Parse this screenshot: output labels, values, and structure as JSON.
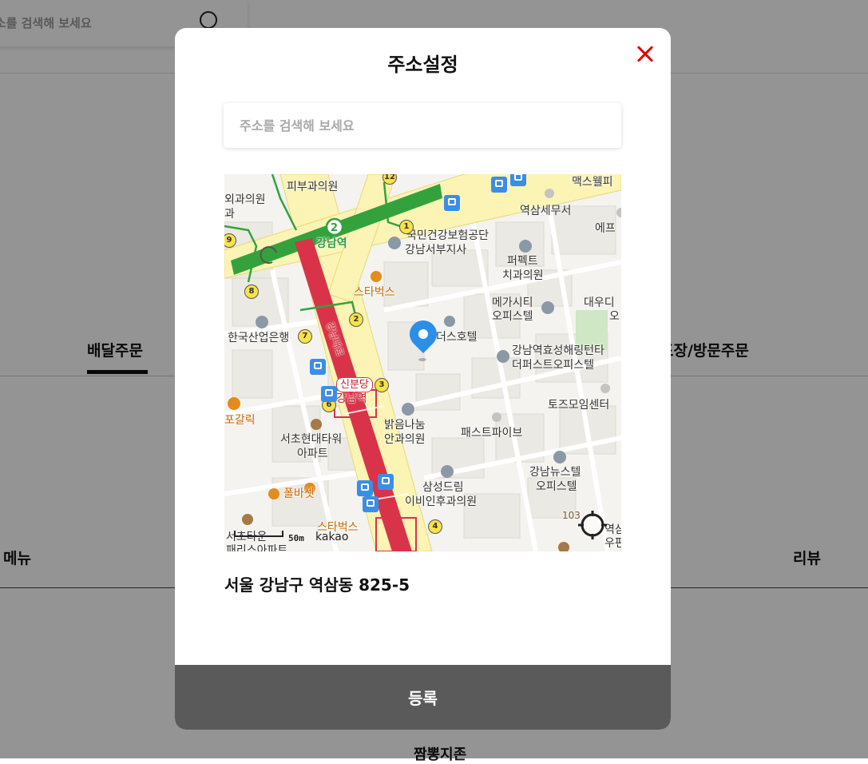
{
  "background": {
    "search_placeholder": "주소를 검색해 보세요",
    "tab_delivery": "배달주문",
    "tab_pickup": "포장/방문주문",
    "section_menu": "메뉴",
    "section_review": "리뷰",
    "item_name": "짬뽕지존"
  },
  "modal": {
    "title": "주소설정",
    "search_placeholder": "주소를 검색해 보세요",
    "address": "서울 강남구 역삼동 825-5",
    "submit_label": "등록"
  },
  "map": {
    "labels": {
      "dermatology": "피부과의원",
      "surgery": "외과의원",
      "clinic": "과",
      "maxwell": "맥스웰피",
      "yeoksam_tax": "역삼세무서",
      "nhis_1": "국민건강보험공단",
      "nhis_2": "강남서부지사",
      "epu": "에프",
      "gangnam_station_green": "강남역",
      "starbucks_1": "스타벅스",
      "perfect_1": "퍼펙트",
      "perfect_2": "치과의원",
      "megacity_1": "메가시티",
      "megacity_2": "오피스텔",
      "daewoo_1": "대우디",
      "daewoo_2": "오",
      "kdb": "한국산업은행",
      "deus_hotel": "더스호텔",
      "hyosung_1": "강남역효성해링턴타",
      "hyosung_2": "더퍼스트오피스텔",
      "sinbundang": "신분당",
      "gangnam_station_red": "강남역",
      "tojeu": "토즈모임센터",
      "pogalbi": "포갈릭",
      "seocho_1": "서초현대타워",
      "seocho_2": "아파트",
      "balgeum_1": "밝음나눔",
      "balgeum_2": "안과의원",
      "pastpive": "패스트파이브",
      "gangnam_news_1": "강남뉴스텔",
      "gangnam_news_2": "오피스텔",
      "paulbassett": "폴바셋",
      "samsung_1": "삼성드림",
      "samsung_2": "이비인후과의원",
      "starbucks_2": "스타벅스",
      "num_103": "103",
      "seochotown_1": "서초타운",
      "seochotown_2": "패리스아파트",
      "yeoksam_right_1": "역삼",
      "yeoksam_right_2": "우편",
      "gangnamdaero": "강남대로"
    },
    "badges": [
      "12",
      "1",
      "9",
      "8",
      "7",
      "2",
      "3",
      "6",
      "4",
      "2"
    ],
    "scale_text": "50m",
    "brand": "kakao"
  },
  "colors": {
    "line2_green": "#33a23d",
    "sinbundang_red": "#d9334a",
    "road_yellow": "#fbf4b4",
    "close_red": "#e60000",
    "pin_blue": "#2b8fe8",
    "button_gray": "#5a5a5a"
  }
}
